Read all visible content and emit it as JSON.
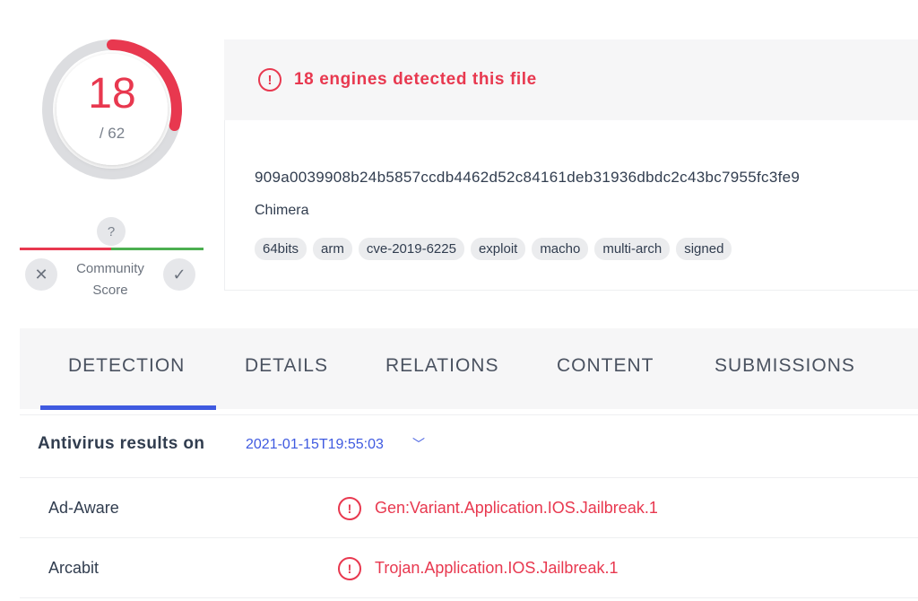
{
  "score": {
    "detected": "18",
    "total_label": "/ 62",
    "detected_value": 18,
    "total_value": 62,
    "color_detected": "#e8384f"
  },
  "community": {
    "badge": "?",
    "label_line1": "Community",
    "label_line2": "Score",
    "negative_icon": "x-icon",
    "positive_icon": "check-icon"
  },
  "header": {
    "alert_icon": "exclamation-circle-icon",
    "alert_text": "18 engines detected this file",
    "hash": "909a0039908b24b5857ccdb4462d52c84161deb31936dbdc2c43bc7955fc3fe9",
    "file_name": "Chimera",
    "tags": [
      "64bits",
      "arm",
      "cve-2019-6225",
      "exploit",
      "macho",
      "multi-arch",
      "signed"
    ]
  },
  "tabs": [
    {
      "label": "DETECTION",
      "active": true
    },
    {
      "label": "DETAILS",
      "active": false
    },
    {
      "label": "RELATIONS",
      "active": false
    },
    {
      "label": "CONTENT",
      "active": false
    },
    {
      "label": "SUBMISSIONS",
      "active": false
    }
  ],
  "section": {
    "title": "Antivirus results on",
    "date": "2021-01-15T19:55:03",
    "dropdown_icon": "chevron-down-icon"
  },
  "results": [
    {
      "engine": "Ad-Aware",
      "result": "Gen:Variant.Application.IOS.Jailbreak.1"
    },
    {
      "engine": "Arcabit",
      "result": "Trojan.Application.IOS.Jailbreak.1"
    }
  ],
  "colors": {
    "danger": "#e8384f",
    "accent": "#3f5ae0",
    "positive": "#4caf50"
  }
}
